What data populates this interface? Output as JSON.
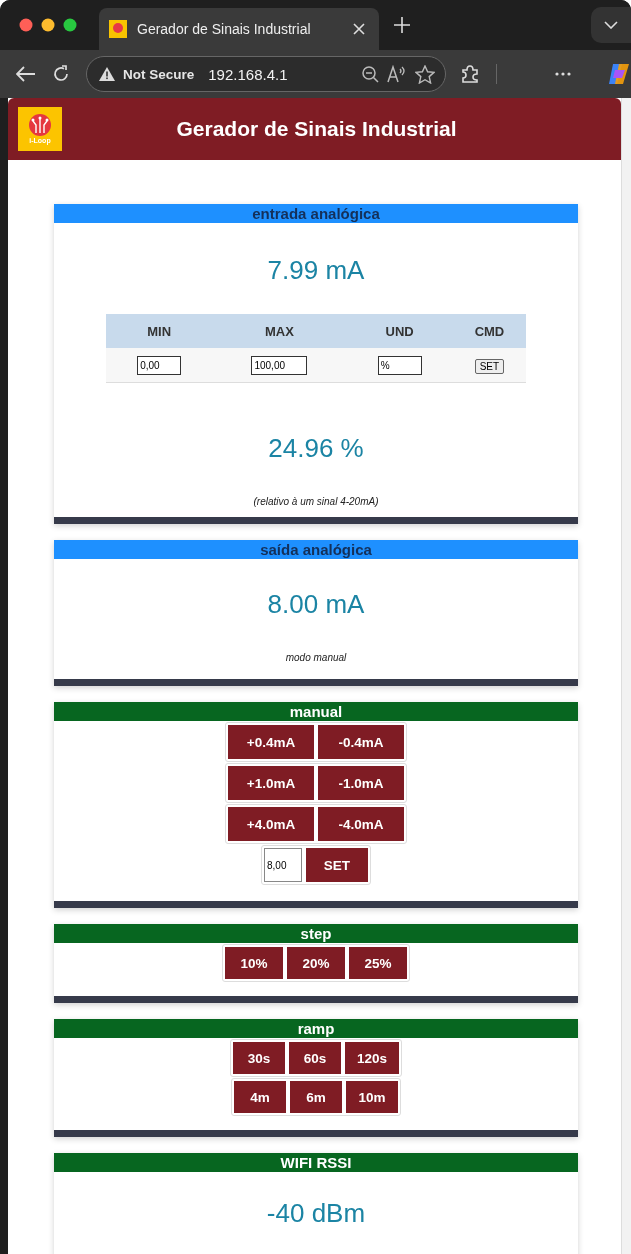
{
  "browser": {
    "tab_title": "Gerador de Sinais Industrial",
    "security": "Not Secure",
    "url": "192.168.4.1"
  },
  "header": {
    "logo_text": "i-Loop",
    "title": "Gerador de Sinais Industrial"
  },
  "sections": [
    {
      "title": "entrada analógica",
      "color": "#1e90ff",
      "items": [
        {
          "kind": "value",
          "text": "7.99 mA"
        },
        {
          "kind": "table",
          "columns": [
            "MIN",
            "MAX",
            "UND",
            "CMD"
          ],
          "cells": [
            {
              "kind": "field",
              "value": "0,00"
            },
            {
              "kind": "field",
              "value": "100,00"
            },
            {
              "kind": "field",
              "value": "%"
            },
            {
              "kind": "button",
              "label": "SET"
            }
          ]
        },
        {
          "kind": "value",
          "text": "24.96 %"
        },
        {
          "kind": "note",
          "text": "(relativo à um sinal 4-20mA)"
        }
      ]
    },
    {
      "title": "saída analógica",
      "color": "#1e90ff",
      "items": [
        {
          "kind": "value",
          "text": "8.00 mA"
        },
        {
          "kind": "note",
          "text": "modo manual"
        }
      ]
    },
    {
      "title": "manual",
      "color": "#076620",
      "items": [
        {
          "kind": "buttons",
          "labels": [
            "+0.4mA",
            "-0.4mA"
          ]
        },
        {
          "kind": "buttons",
          "labels": [
            "+1.0mA",
            "-1.0mA"
          ]
        },
        {
          "kind": "buttons",
          "labels": [
            "+4.0mA",
            "-4.0mA"
          ]
        },
        {
          "kind": "set",
          "value": "8,00",
          "label": "SET"
        }
      ]
    },
    {
      "title": "step",
      "color": "#076620",
      "items": [
        {
          "kind": "buttons",
          "labels": [
            "10%",
            "20%",
            "25%"
          ]
        }
      ]
    },
    {
      "title": "ramp",
      "color": "#076620",
      "items": [
        {
          "kind": "buttons",
          "labels": [
            "30s",
            "60s",
            "120s"
          ]
        },
        {
          "kind": "buttons",
          "labels": [
            "4m",
            "6m",
            "10m"
          ]
        }
      ]
    },
    {
      "title": "WIFI RSSI",
      "color": "#076620",
      "items": [
        {
          "kind": "value",
          "text": "-40 dBm"
        }
      ]
    }
  ]
}
